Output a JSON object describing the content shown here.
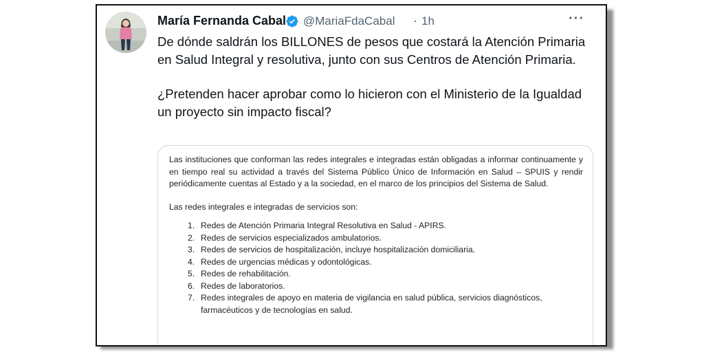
{
  "tweet": {
    "author": {
      "name": "María Fernanda Cabal",
      "handle": "@MariaFdaCabal",
      "separator": "·",
      "time": "1h",
      "verified": true,
      "verified_color": "#1d9bf0"
    },
    "more_label": "···",
    "paragraphs": [
      "De dónde saldrán los BILLONES de pesos que costará la Atención Primaria en Salud Integral y resolutiva, junto con sus Centros de Atención Primaria.",
      "¿Pretenden hacer aprobar como lo hicieron con el Ministerio de la Igualdad un proyecto sin impacto fiscal?"
    ]
  },
  "document": {
    "paragraph1": "Las instituciones que conforman las redes integrales e integradas están obligadas a informar continuamente y en tiempo real su actividad a través del Sistema Público Único de Información en Salud – SPUIS y rendir periódicamente cuentas al Estado y a la sociedad, en el marco de los principios del Sistema de Salud.",
    "list_intro": "Las redes integrales e integradas de servicios son:",
    "items": [
      {
        "num": "1.",
        "text": "Redes de Atención Primaria Integral Resolutiva en Salud - APIRS."
      },
      {
        "num": "2.",
        "text": "Redes de servicios especializados ambulatorios."
      },
      {
        "num": "3.",
        "text": "Redes de servicios de hospitalización, incluye hospitalización domiciliaria."
      },
      {
        "num": "4.",
        "text": "Redes de urgencias médicas y odontológicas."
      },
      {
        "num": "5.",
        "text": "Redes de rehabilitación."
      },
      {
        "num": "6.",
        "text": "Redes de laboratorios."
      },
      {
        "num": "7.",
        "text": "Redes integrales de apoyo en materia de vigilancia en salud pública, servicios diagnósticos, farmacéuticos y de tecnologías en salud."
      }
    ]
  }
}
